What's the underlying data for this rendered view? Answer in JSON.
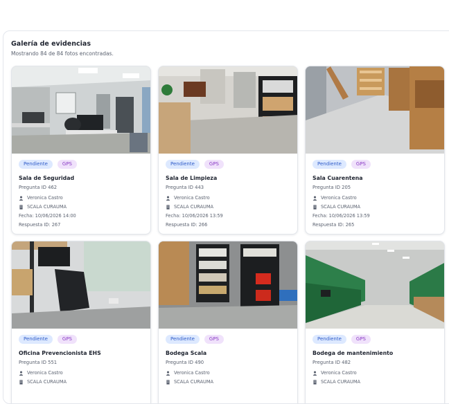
{
  "gallery": {
    "title": "Galería de evidencias",
    "subtitle": "Mostrando 84 de 84 fotos encontradas."
  },
  "icons": {
    "user": "user-icon",
    "building": "building-icon"
  },
  "colors": {
    "pending_badge_bg": "#dde9ff",
    "pending_badge_text": "#2f5bc8",
    "gps_badge_bg": "#f0e2fb",
    "gps_badge_text": "#8a3bc4"
  },
  "cards": [
    {
      "badge_status": "Pendiente",
      "badge_gps": "GPS",
      "title": "Sala de Seguridad",
      "question": "Pregunta ID 462",
      "user": "Veronica Castro",
      "site": "SCALA CURAUMA",
      "date": "Fecha: 10/06/2026 14:00",
      "response": "Respuesta ID: 267"
    },
    {
      "badge_status": "Pendiente",
      "badge_gps": "GPS",
      "title": "Sala de Limpieza",
      "question": "Pregunta ID 443",
      "user": "Veronica Castro",
      "site": "SCALA CURAUMA",
      "date": "Fecha: 10/06/2026 13:59",
      "response": "Respuesta ID: 266"
    },
    {
      "badge_status": "Pendiente",
      "badge_gps": "GPS",
      "title": "Sala Cuarentena",
      "question": "Pregunta ID 205",
      "user": "Veronica Castro",
      "site": "SCALA CURAUMA",
      "date": "Fecha: 10/06/2026 13:59",
      "response": "Respuesta ID: 265"
    },
    {
      "badge_status": "Pendiente",
      "badge_gps": "GPS",
      "title": "Oficina Prevencionista EHS",
      "question": "Pregunta ID 551",
      "user": "Veronica Castro",
      "site": "SCALA CURAUMA",
      "date": "",
      "response": ""
    },
    {
      "badge_status": "Pendiente",
      "badge_gps": "GPS",
      "title": "Bodega Scala",
      "question": "Pregunta ID 490",
      "user": "Veronica Castro",
      "site": "SCALA CURAUMA",
      "date": "",
      "response": ""
    },
    {
      "badge_status": "Pendiente",
      "badge_gps": "GPS",
      "title": "Bodega de mantenimiento",
      "question": "Pregunta ID 482",
      "user": "Veronica Castro",
      "site": "SCALA CURAUMA",
      "date": "",
      "response": ""
    }
  ]
}
